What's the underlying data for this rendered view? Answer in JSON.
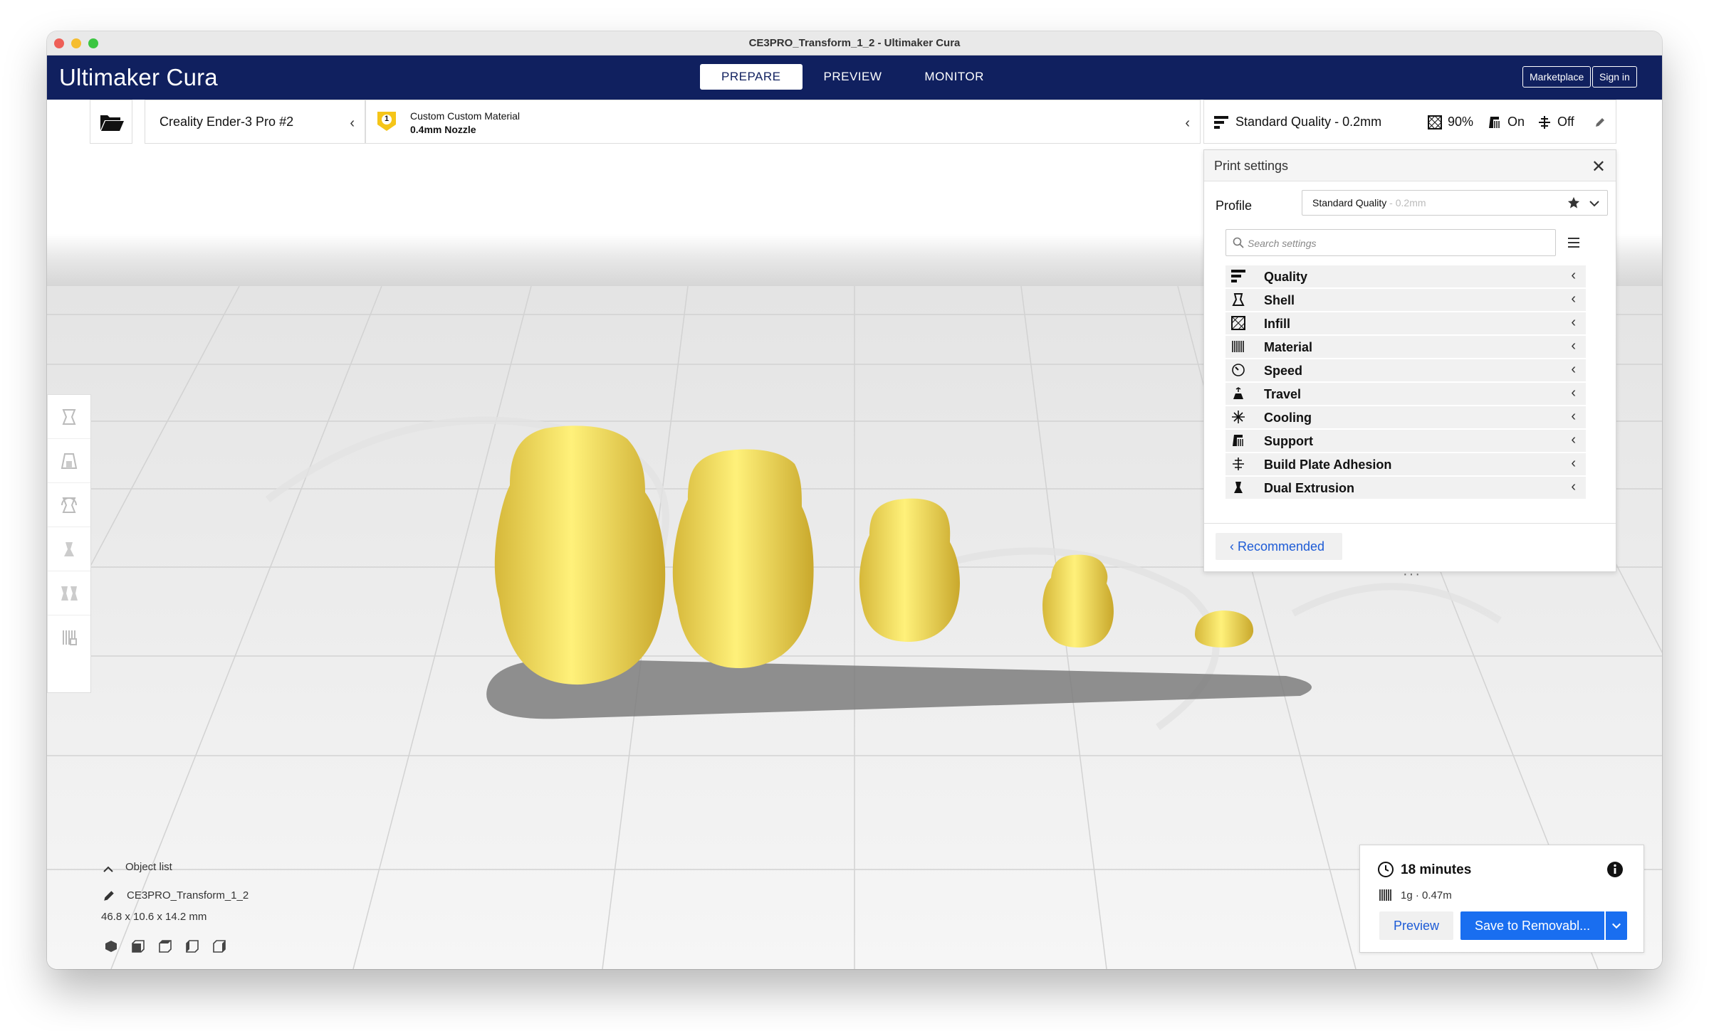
{
  "window": {
    "title": "CE3PRO_Transform_1_2 - Ultimaker Cura"
  },
  "header": {
    "brand_bold": "Ultimaker",
    "brand_light": "Cura",
    "tabs": [
      {
        "label": "PREPARE",
        "active": true
      },
      {
        "label": "PREVIEW",
        "active": false
      },
      {
        "label": "MONITOR",
        "active": false
      }
    ],
    "marketplace_label": "Marketplace",
    "signin_label": "Sign in"
  },
  "toolbar": {
    "printer_name": "Creality Ender-3 Pro #2",
    "material_badge": "1",
    "material_name": "Custom Custom Material",
    "nozzle": "0.4mm Nozzle",
    "quality_label": "Standard Quality - 0.2mm",
    "infill_value": "90%",
    "support_value": "On",
    "adhesion_value": "Off"
  },
  "print_settings": {
    "title": "Print settings",
    "profile_label": "Profile",
    "profile_name": "Standard Quality",
    "profile_sub": " - 0.2mm",
    "search_placeholder": "Search settings",
    "categories": [
      {
        "label": "Quality",
        "icon": "quality-icon"
      },
      {
        "label": "Shell",
        "icon": "shell-icon"
      },
      {
        "label": "Infill",
        "icon": "infill-icon"
      },
      {
        "label": "Material",
        "icon": "material-icon"
      },
      {
        "label": "Speed",
        "icon": "speed-icon"
      },
      {
        "label": "Travel",
        "icon": "travel-icon"
      },
      {
        "label": "Cooling",
        "icon": "cooling-icon"
      },
      {
        "label": "Support",
        "icon": "support-icon"
      },
      {
        "label": "Build Plate Adhesion",
        "icon": "adhesion-icon"
      },
      {
        "label": "Dual Extrusion",
        "icon": "dual-extrusion-icon"
      }
    ],
    "recommended_label": "Recommended"
  },
  "object_list": {
    "header": "Object list",
    "object_name": "CE3PRO_Transform_1_2",
    "dimensions": "46.8 x 10.6 x 14.2 mm"
  },
  "job": {
    "time": "18 minutes",
    "usage": "1g · 0.47m",
    "preview_label": "Preview",
    "save_label": "Save to Removabl..."
  },
  "colors": {
    "header_bg": "#10205f",
    "accent": "#196ef0",
    "model": "#f9dc5c"
  }
}
